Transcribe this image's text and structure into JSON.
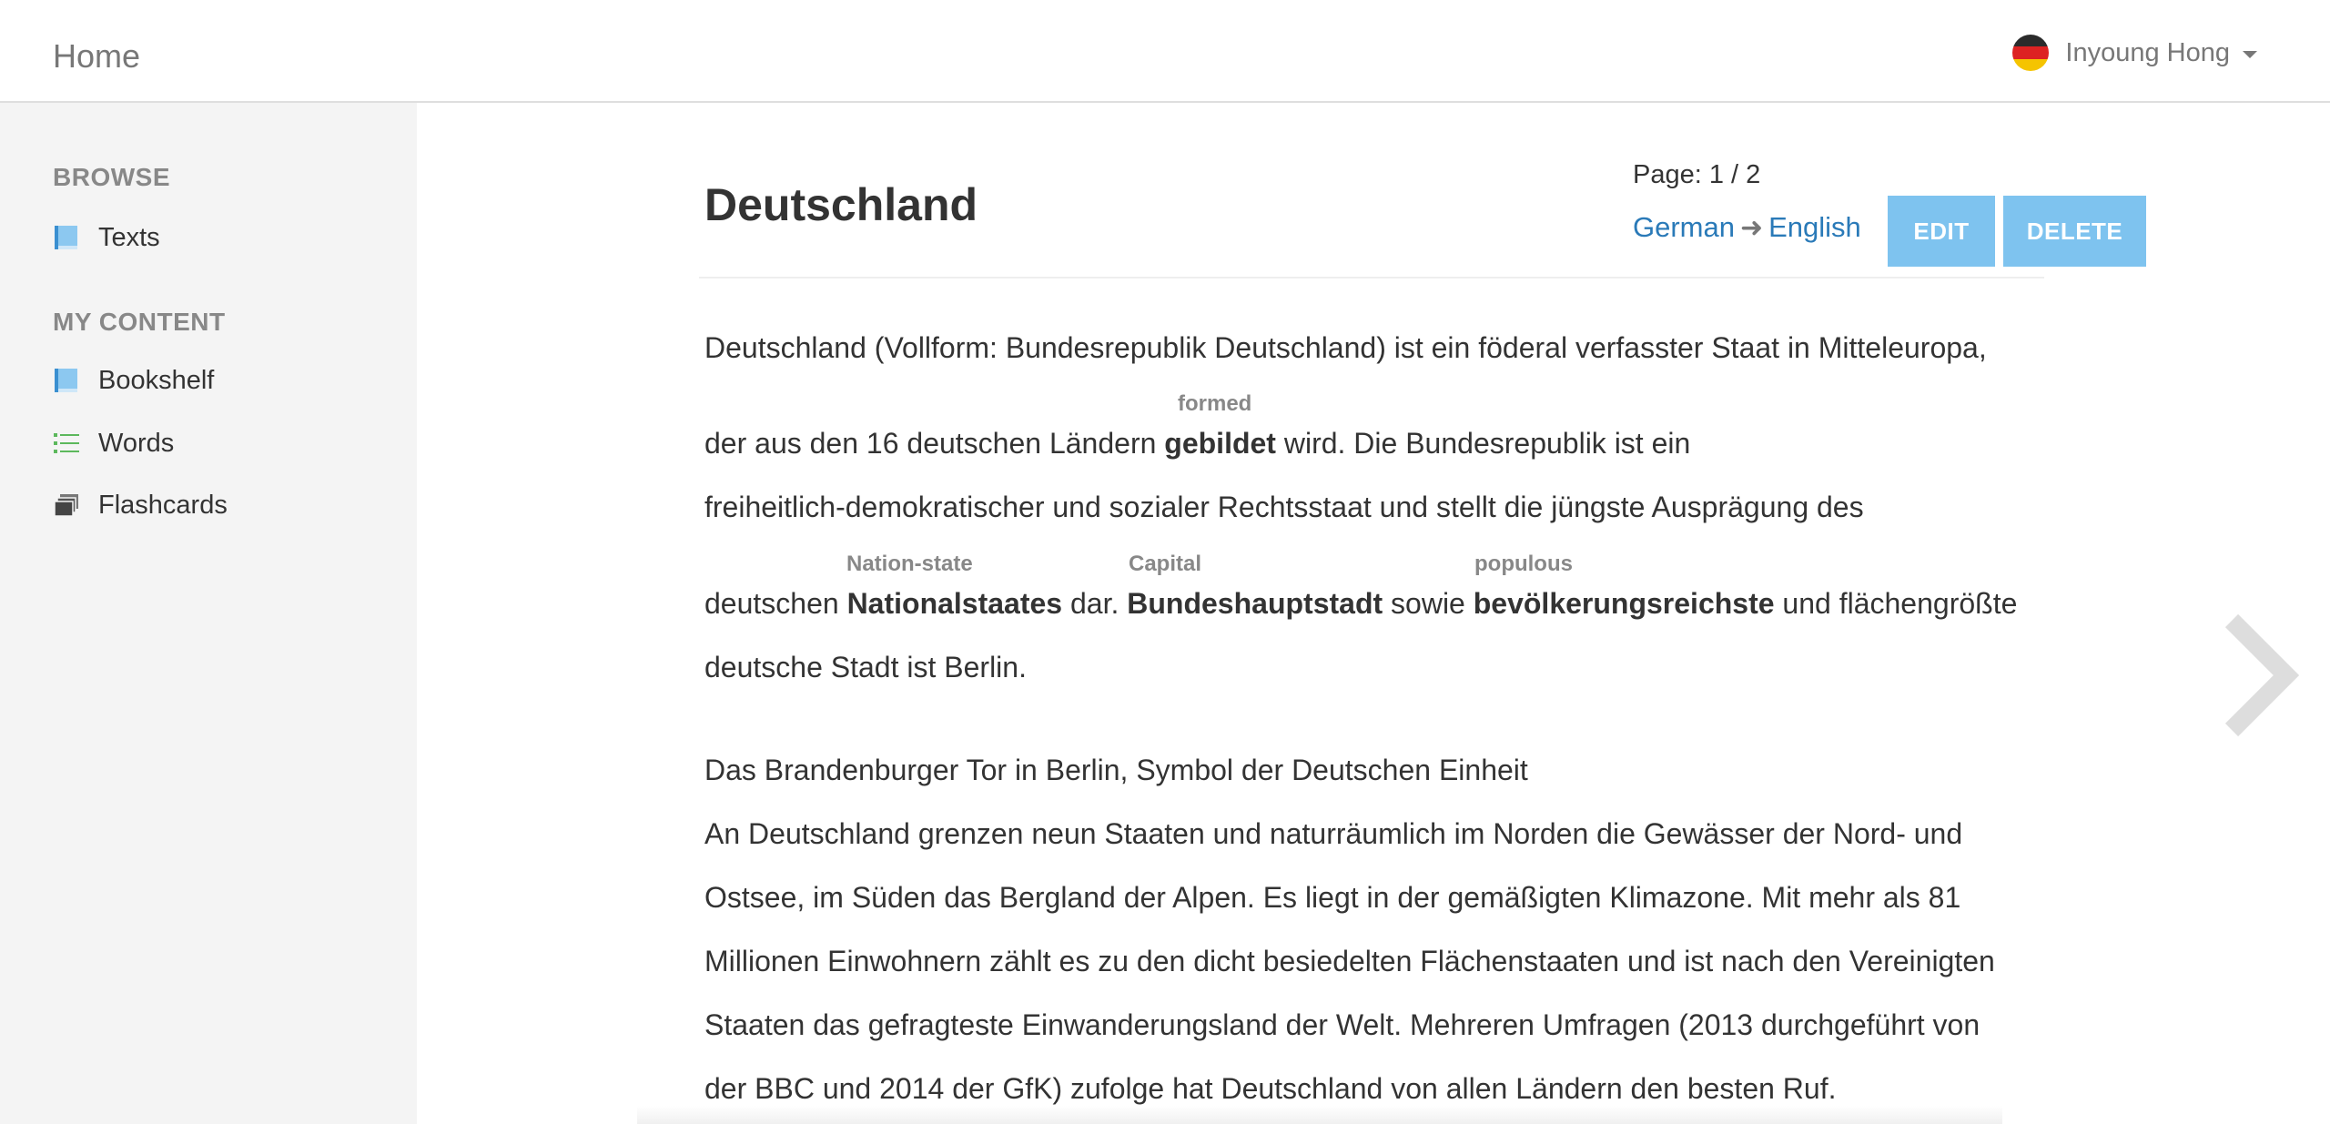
{
  "navbar": {
    "brand": "Home",
    "user_name": "Inyoung Hong"
  },
  "sidebar": {
    "browse_heading": "BROWSE",
    "browse_items": [
      {
        "label": "Texts",
        "icon": "book-icon"
      }
    ],
    "my_content_heading": "MY CONTENT",
    "my_content_items": [
      {
        "label": "Bookshelf",
        "icon": "book-icon"
      },
      {
        "label": "Words",
        "icon": "list-icon"
      },
      {
        "label": "Flashcards",
        "icon": "cards-icon"
      }
    ]
  },
  "text": {
    "title": "Deutschland",
    "page_label": "Page: 1 / 2",
    "source_language": "German",
    "target_language": "English",
    "edit_label": "EDIT",
    "delete_label": "DELETE"
  },
  "paragraph1": {
    "line1": "Deutschland (Vollform: Bundesrepublik Deutschland) ist ein föderal verfasster Staat in Mitteleuropa,",
    "line2": {
      "before": "der aus den 16 deutschen Ländern ",
      "word": "gebildet",
      "word_gloss": "formed",
      "after": " wird. Die Bundesrepublik ist ein"
    },
    "line3": "freiheitlich-demokratischer und sozialer Rechtsstaat und stellt die jüngste Ausprägung des",
    "line4": {
      "t1": "deutschen ",
      "w1": "Nationalstaates",
      "g1": "Nation-state",
      "t2": " dar. ",
      "w2": "Bundeshauptstadt",
      "g2": "Capital",
      "t3": " sowie ",
      "w3": "bevölkerungsreichste",
      "g3": "populous",
      "t4": " und flächengrößte"
    },
    "line5": "deutsche Stadt ist Berlin."
  },
  "paragraph2": {
    "caption": "Das Brandenburger Tor in Berlin, Symbol der Deutschen Einheit",
    "lines": [
      "An Deutschland grenzen neun Staaten und naturräumlich im Norden die Gewässer der Nord- und",
      "Ostsee, im Süden das Bergland der Alpen. Es liegt in der gemäßigten Klimazone. Mit mehr als 81",
      "Millionen Einwohnern zählt es zu den dicht besiedelten Flächenstaaten und ist nach den Vereinigten",
      "Staaten das gefragteste Einwanderungsland der Welt. Mehreren Umfragen (2013 durchgeführt von",
      "der BBC und 2014 der GfK) zufolge hat Deutschland von allen Ländern den besten Ruf."
    ]
  },
  "colors": {
    "link": "#2a7ab8",
    "button": "#7ec3ef",
    "sidebar_bg": "#f4f4f4",
    "gloss": "#888888"
  }
}
